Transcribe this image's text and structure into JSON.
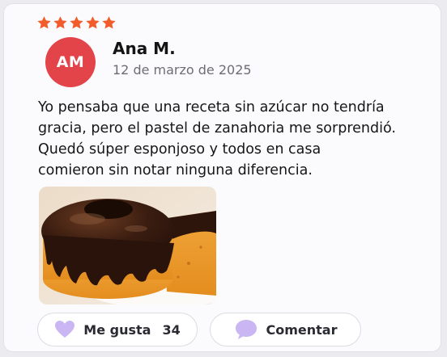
{
  "review": {
    "rating": 5,
    "star_color": "#f25c2a",
    "author": {
      "initials": "AM",
      "name": "Ana M.",
      "avatar_color": "#e3444a"
    },
    "date": "12 de marzo de 2025",
    "text_lines": [
      "Yo pensaba que una receta sin azúcar no tendría",
      "gracia, pero el pastel de zanahoria me sorprendió.",
      "Quedó súper esponjoso y todos en casa",
      "comieron sin notar ninguna diferencia."
    ],
    "photo": "carrot-cake-with-chocolate-glaze"
  },
  "actions": {
    "like": {
      "label": "Me gusta",
      "count": "34",
      "icon": "heart-icon",
      "icon_color": "#c9b6f2"
    },
    "comment": {
      "label": "Comentar",
      "icon": "speech-bubble-icon",
      "icon_color": "#c9b6f2"
    }
  }
}
